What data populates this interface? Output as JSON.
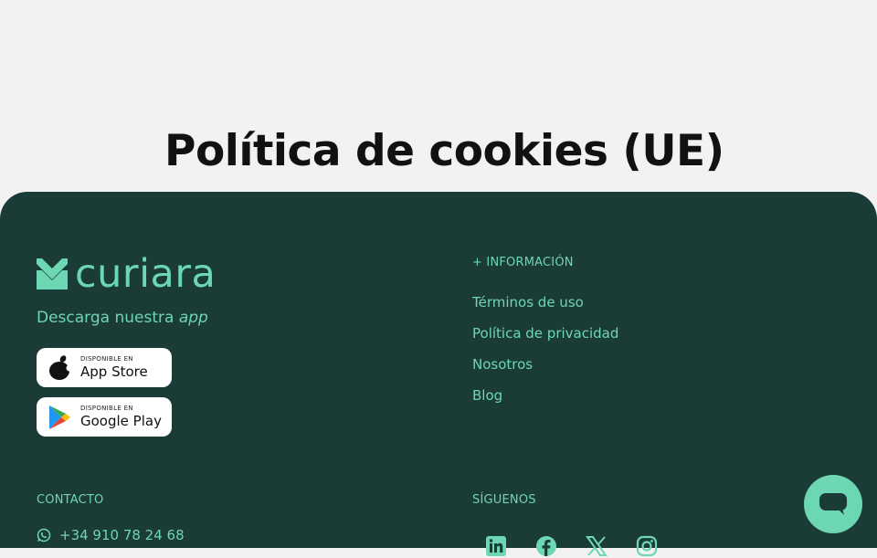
{
  "page": {
    "title": "Política de cookies (UE)"
  },
  "footer": {
    "brand": "curiara",
    "download_prefix": "Descarga nuestra ",
    "download_emphasis": "app",
    "app_store": {
      "small": "DISPONIBLE EN",
      "big": "App Store"
    },
    "google_play": {
      "small": "DISPONIBLE EN",
      "big": "Google Play"
    },
    "info_heading": "+ INFORMACIÓN",
    "info_links": [
      "Términos de uso",
      "Política de privacidad",
      "Nosotros",
      "Blog"
    ],
    "contact_heading": "CONTACTO",
    "phone": "+34 910 78 24 68",
    "follow_heading": "SÍGUENOS",
    "social_icons": [
      "linkedin-icon",
      "facebook-icon",
      "x-icon",
      "instagram-icon"
    ]
  },
  "colors": {
    "accent": "#6dd6b3",
    "footer_bg": "#1b3b36",
    "page_bg": "#f2f2f2",
    "title": "#111111"
  }
}
